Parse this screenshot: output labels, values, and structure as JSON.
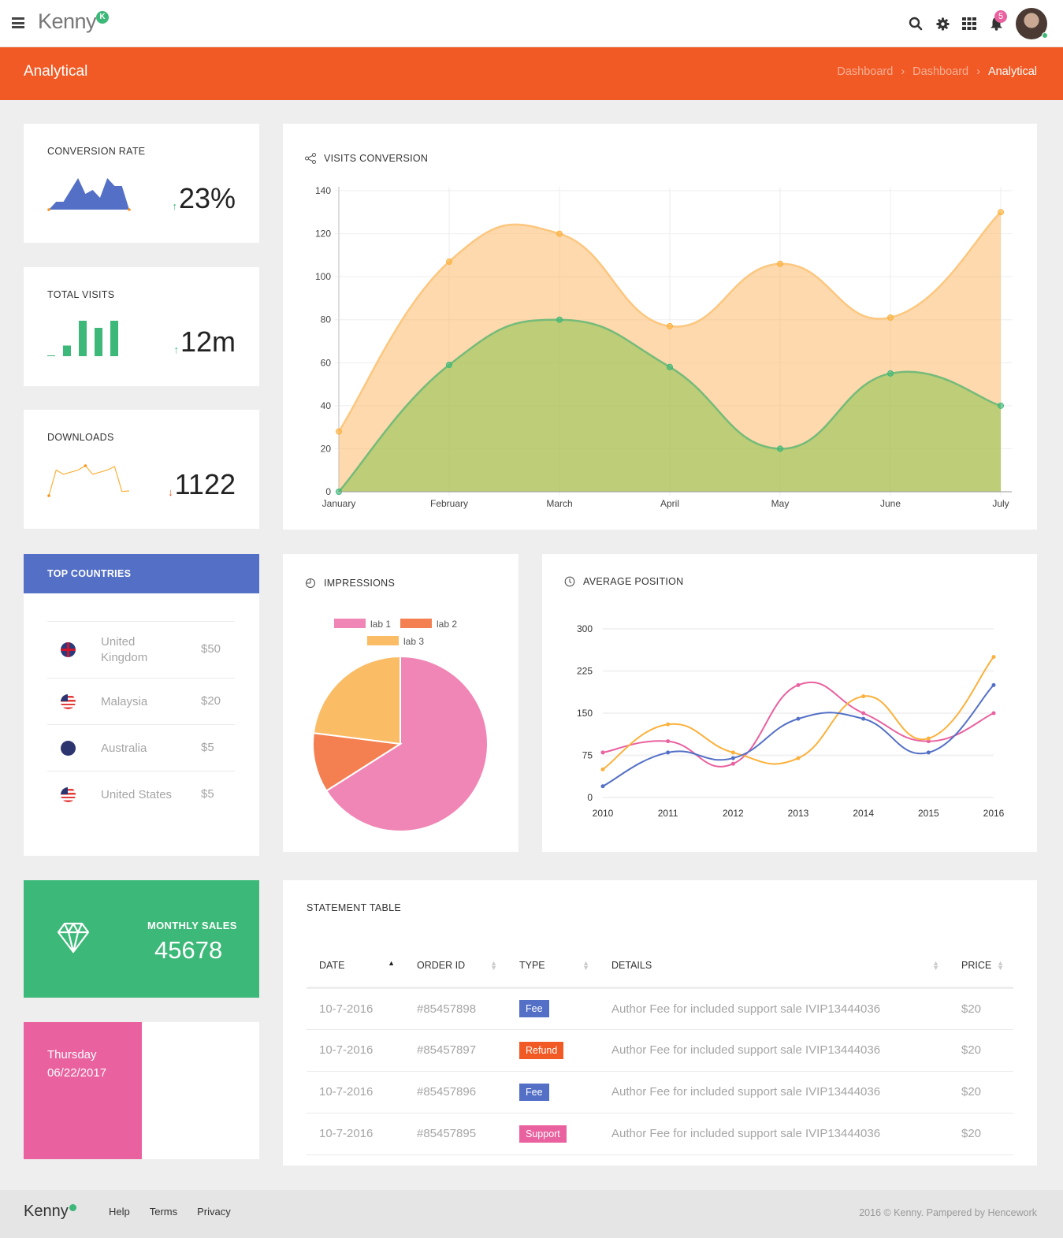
{
  "header": {
    "brand": "Kenny",
    "brand_badge": "K",
    "notifications_count": "5",
    "icons": [
      "menu-icon",
      "search-icon",
      "gear-icon",
      "apps-grid-icon",
      "bell-icon",
      "avatar"
    ]
  },
  "titlebar": {
    "title": "Analytical",
    "breadcrumb": [
      "Dashboard",
      "Dashboard",
      "Analytical"
    ]
  },
  "stats": {
    "conversion": {
      "title": "CONVERSION RATE",
      "value": "23%",
      "trend": "up",
      "spark": [
        0,
        2,
        2,
        5,
        8,
        4,
        5,
        3,
        8,
        6,
        6,
        0
      ]
    },
    "visits": {
      "title": "TOTAL VISITS",
      "value": "12m",
      "trend": "up",
      "bars": [
        0,
        3,
        10,
        8,
        10
      ]
    },
    "downloads": {
      "title": "DOWNLOADS",
      "value": "1122",
      "trend": "down",
      "spark": [
        0,
        6,
        5,
        5.5,
        6,
        7,
        5,
        5.5,
        6,
        6.8,
        1,
        1.1
      ]
    }
  },
  "colors": {
    "orange": "#f15a24",
    "blue": "#5470c6",
    "green": "#3cb878",
    "pink": "#e9619f",
    "amber": "#fbb45c"
  },
  "visits_conversion": {
    "title": "VISITS CONVERSION",
    "chart_data": {
      "type": "area",
      "categories": [
        "January",
        "February",
        "March",
        "April",
        "May",
        "June",
        "July"
      ],
      "series": [
        {
          "name": "series-1",
          "values": [
            28,
            107,
            120,
            77,
            106,
            81,
            130
          ],
          "color": "#fbb45c"
        },
        {
          "name": "series-2",
          "values": [
            0,
            59,
            80,
            58,
            20,
            55,
            40
          ],
          "color": "#8bc34a"
        }
      ],
      "yticks": [
        0,
        20,
        40,
        60,
        80,
        100,
        120,
        140
      ],
      "ylim": [
        0,
        140
      ],
      "grid": true
    }
  },
  "top_countries": {
    "title": "TOP COUNTRIES",
    "items": [
      {
        "name": "United Kingdom",
        "price": "$50",
        "flag": "uk-flag-icon"
      },
      {
        "name": "Malaysia",
        "price": "$20",
        "flag": "malaysia-flag-icon"
      },
      {
        "name": "Australia",
        "price": "$5",
        "flag": "australia-flag-icon"
      },
      {
        "name": "United States",
        "price": "$5",
        "flag": "us-flag-icon"
      }
    ]
  },
  "impressions": {
    "title": "IMPRESSIONS",
    "chart_data": {
      "type": "pie",
      "labels": [
        "lab 1",
        "lab 2",
        "lab 3"
      ],
      "values": [
        66,
        11,
        23
      ],
      "colors": [
        "#f086b6",
        "#f47f51",
        "#fbbc66"
      ],
      "legend": "top"
    }
  },
  "average_position": {
    "title": "AVERAGE POSITION",
    "chart_data": {
      "type": "line",
      "x": [
        "2010",
        "2011",
        "2012",
        "2013",
        "2014",
        "2015",
        "2016"
      ],
      "series": [
        {
          "name": "pink",
          "values": [
            80,
            100,
            60,
            200,
            150,
            100,
            150
          ],
          "color": "#e9619f"
        },
        {
          "name": "amber",
          "values": [
            50,
            130,
            80,
            70,
            180,
            105,
            250
          ],
          "color": "#fbb13c"
        },
        {
          "name": "blue",
          "values": [
            20,
            80,
            70,
            140,
            140,
            80,
            200
          ],
          "color": "#5470c6"
        }
      ],
      "yticks": [
        0,
        75,
        150,
        225,
        300
      ],
      "ylim": [
        0,
        300
      ],
      "grid": true
    }
  },
  "monthly_sales": {
    "label": "MONTHLY SALES",
    "value": "45678"
  },
  "date_card": {
    "day": "Thursday",
    "date": "06/22/2017"
  },
  "statement": {
    "title": "STATEMENT TABLE",
    "columns": [
      "DATE",
      "ORDER ID",
      "TYPE",
      "DETAILS",
      "PRICE"
    ],
    "rows": [
      {
        "date": "10-7-2016",
        "order": "#85457898",
        "type": "Fee",
        "type_color": "#5470c6",
        "details": "Author Fee for included support sale IVIP13444036",
        "price": "$20"
      },
      {
        "date": "10-7-2016",
        "order": "#85457897",
        "type": "Refund",
        "type_color": "#f15a24",
        "details": "Author Fee for included support sale IVIP13444036",
        "price": "$20"
      },
      {
        "date": "10-7-2016",
        "order": "#85457896",
        "type": "Fee",
        "type_color": "#5470c6",
        "details": "Author Fee for included support sale IVIP13444036",
        "price": "$20"
      },
      {
        "date": "10-7-2016",
        "order": "#85457895",
        "type": "Support",
        "type_color": "#e9619f",
        "details": "Author Fee for included support sale IVIP13444036",
        "price": "$20"
      }
    ]
  },
  "footer": {
    "brand": "Kenny",
    "links": [
      "Help",
      "Terms",
      "Privacy"
    ],
    "copyright": "2016 © Kenny. Pampered by Hencework"
  }
}
